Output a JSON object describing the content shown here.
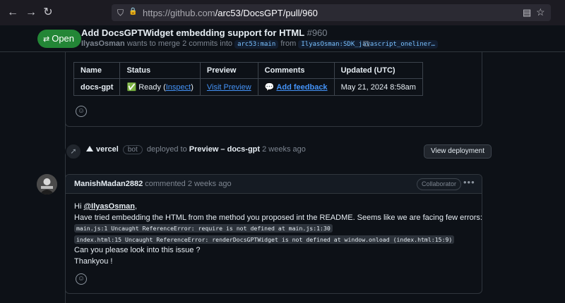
{
  "browser": {
    "url_host": "https://github.com",
    "url_path": "/arc53/DocsGPT/pull/960"
  },
  "pr": {
    "status": "Open",
    "title": "Add DocsGPTWidget embedding support for HTML",
    "number": "#960",
    "author": "IlyasOsman",
    "merge_text": "wants to merge 2 commits into",
    "base_branch": "arc53:main",
    "from_text": "from",
    "head_branch": "IlyasOsman:SDK_javascript_oneliner…"
  },
  "deploy_table": {
    "headers": [
      "Name",
      "Status",
      "Preview",
      "Comments",
      "Updated (UTC)"
    ],
    "row": {
      "name": "docs-gpt",
      "status_icon": "✅",
      "status": "Ready",
      "status_paren_open": "(",
      "inspect": "Inspect",
      "status_paren_close": ")",
      "preview": "Visit Preview",
      "comment_icon": "💬",
      "comments": "Add feedback",
      "updated": "May 21, 2024 8:58am"
    }
  },
  "deploy_event": {
    "actor": "vercel",
    "badge": "bot",
    "action": "deployed to",
    "target": "Preview – docs-gpt",
    "time": "2 weeks ago",
    "button": "View deployment"
  },
  "comment": {
    "author": "ManishMadan2882",
    "action": "commented",
    "time": "2 weeks ago",
    "role": "Collaborator",
    "greeting": "Hi",
    "mention": "@IlyasOsman",
    "greeting_end": ",",
    "line1": "Have tried embedding the HTML from the method you proposed int the README. Seems like we are facing few errors:",
    "code1": "main.js:1 Uncaught ReferenceError: require is not defined at main.js:1:30",
    "code2": "index.html:15 Uncaught ReferenceError: renderDocsGPTWidget is not defined at window.onload (index.html:15:9)",
    "line2": "Can you please look into this issue ?",
    "line3": "Thankyou !"
  },
  "icons": {
    "back": "←",
    "forward": "→",
    "reload": "↻",
    "shield": "⛉",
    "lock": "🔒",
    "reader": "▤",
    "star": "☆",
    "pr": "⇄",
    "copy": "⧉",
    "smiley": "☺",
    "rocket": "➚",
    "kebab": "•••"
  }
}
